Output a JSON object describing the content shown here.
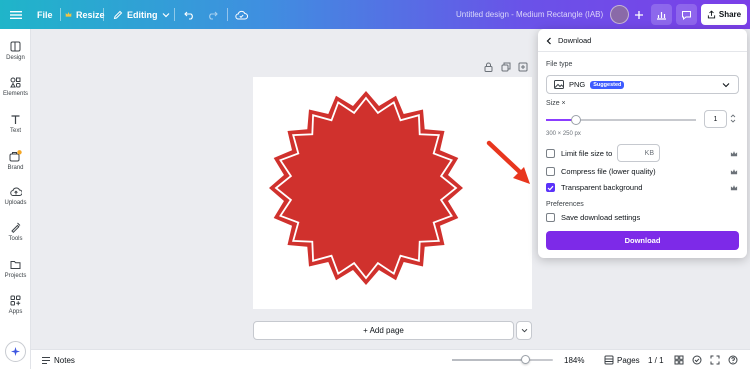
{
  "topbar": {
    "file_label": "File",
    "resize_label": "Resize",
    "editing_label": "Editing",
    "doc_title": "Untitled design - Medium Rectangle (IAB)",
    "share_label": "Share"
  },
  "sidebar": {
    "items": [
      {
        "label": "Design",
        "icon": "design-icon"
      },
      {
        "label": "Elements",
        "icon": "elements-icon"
      },
      {
        "label": "Text",
        "icon": "text-icon"
      },
      {
        "label": "Brand",
        "icon": "brand-icon"
      },
      {
        "label": "Uploads",
        "icon": "uploads-icon"
      },
      {
        "label": "Tools",
        "icon": "tools-icon"
      },
      {
        "label": "Projects",
        "icon": "projects-icon"
      },
      {
        "label": "Apps",
        "icon": "apps-icon"
      }
    ]
  },
  "canvas": {
    "add_page_label": "+ Add page",
    "shape_color": "#d0312d"
  },
  "download_panel": {
    "title": "Download",
    "file_type_label": "File type",
    "file_type_value": "PNG",
    "suggested_badge": "Suggested",
    "size_label": "Size ×",
    "size_multiplier": "1",
    "size_fraction": 0.2,
    "dimensions": "300 × 250 px",
    "limit_label": "Limit file size to",
    "limit_unit": "KB",
    "compress_label": "Compress file (lower quality)",
    "transparent_label": "Transparent background",
    "preferences_label": "Preferences",
    "save_settings_label": "Save download settings",
    "download_button": "Download",
    "accent": "#7d2ae8"
  },
  "bottombar": {
    "notes_label": "Notes",
    "zoom_fraction": 0.72,
    "zoom_label": "184%",
    "pages_label": "Pages",
    "page_count": "1 / 1"
  },
  "colors": {
    "arrow": "#e8361e",
    "topbar_start": "#1fb5c9",
    "topbar_end": "#7b3fe8"
  }
}
